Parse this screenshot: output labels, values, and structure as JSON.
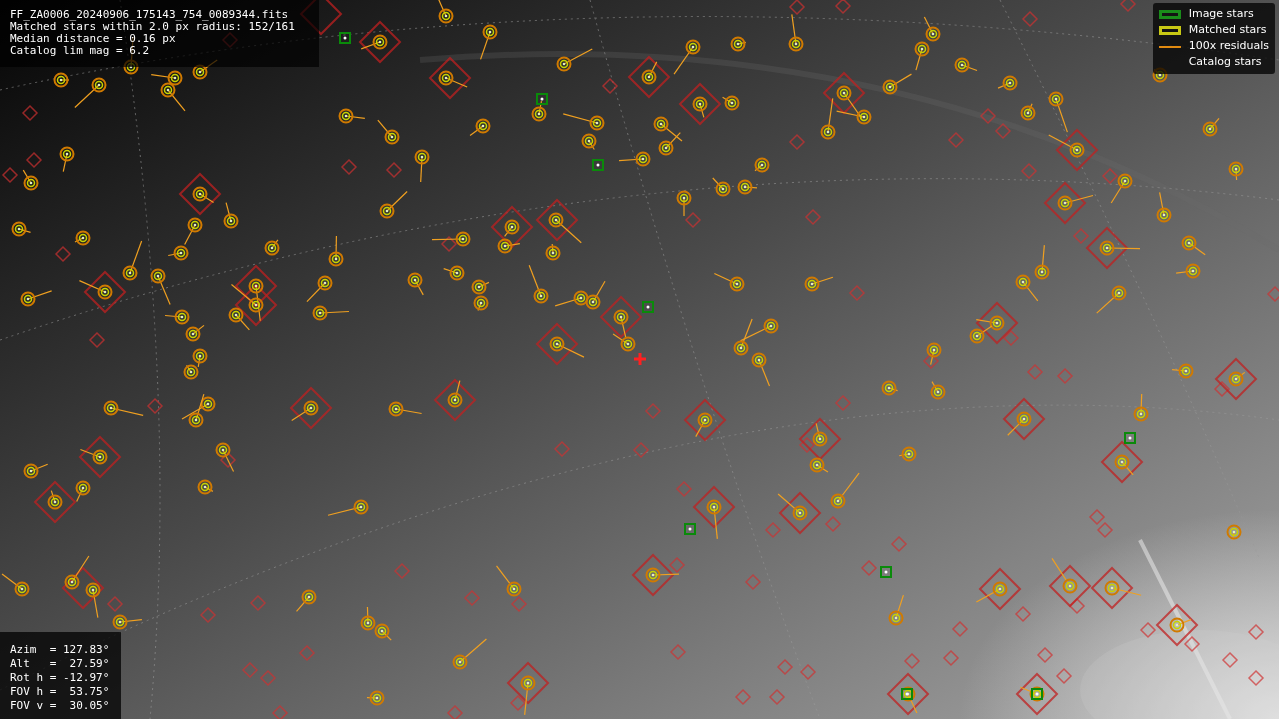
{
  "plot_info": {
    "lines": [
      "FF_ZA0006_20240906_175143_754_0089344.fits",
      "Matched stars within 2.0 px radius: 152/161",
      "Median distance = 0.16 px",
      "Catalog lim mag = 6.2"
    ]
  },
  "legend": {
    "items": [
      {
        "label": "Image stars",
        "kind": "square",
        "color": "#1a8c1a"
      },
      {
        "label": "Matched stars",
        "kind": "square",
        "color": "#c8c814"
      },
      {
        "label": "100x residuals",
        "kind": "line",
        "color": "#e08a10"
      },
      {
        "label": "Catalog stars"
      }
    ]
  },
  "pointing": {
    "lines": [
      "Azim  = 127.83°",
      "Alt   =  27.59°",
      "Rot h = -12.97°",
      "FOV h =  53.75°",
      "FOV v =  30.05°"
    ]
  }
}
